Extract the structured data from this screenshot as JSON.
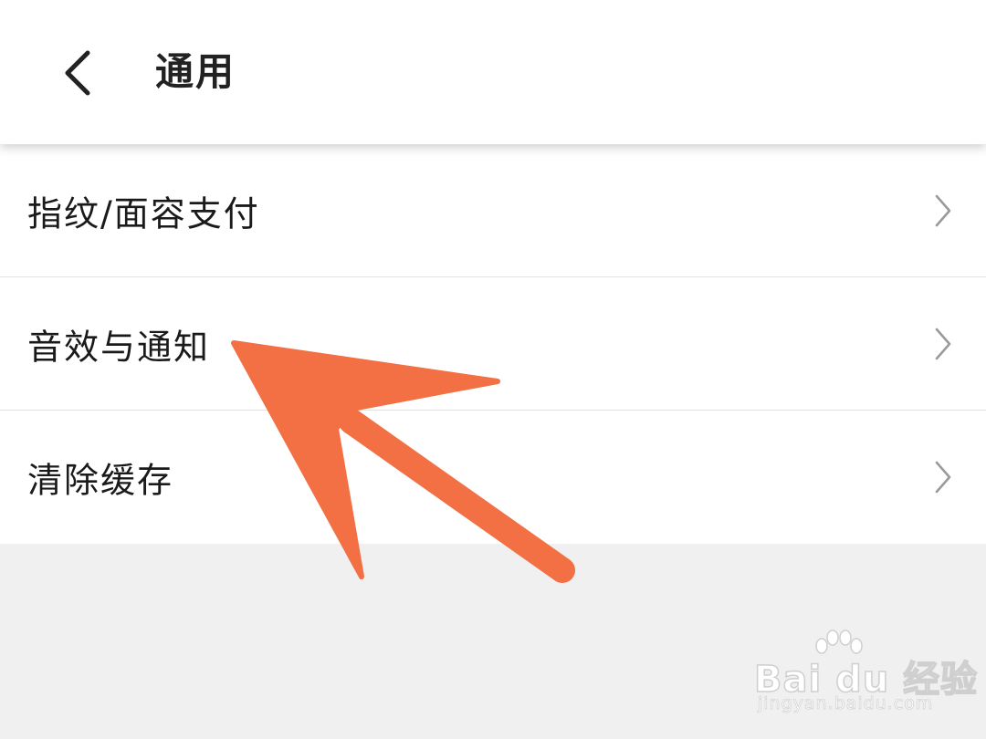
{
  "header": {
    "back_icon": "chevron-left-icon",
    "title": "通用"
  },
  "settings": {
    "items": [
      {
        "label": "指纹/面容支付",
        "icon": "chevron-right-icon"
      },
      {
        "label": "音效与通知",
        "icon": "chevron-right-icon"
      },
      {
        "label": "清除缓存",
        "icon": "chevron-right-icon"
      }
    ]
  },
  "annotation": {
    "type": "arrow",
    "color": "#f27044",
    "points_to": "音效与通知"
  },
  "watermark": {
    "brand": "Bai du 经验",
    "url": "jingyan.baidu.com"
  },
  "colors": {
    "background": "#f0f0f0",
    "surface": "#ffffff",
    "text": "#1a1a1a",
    "chevron": "#9a9a9a",
    "arrow": "#f27044"
  }
}
